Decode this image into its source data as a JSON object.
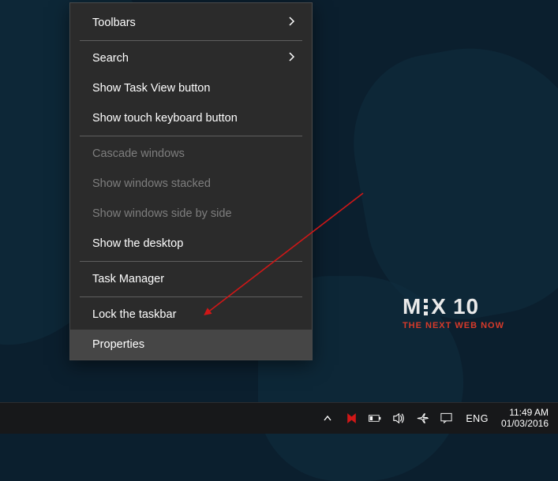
{
  "contextMenu": {
    "items": [
      {
        "label": "Toolbars",
        "enabled": true,
        "submenu": true
      },
      {
        "separator": true
      },
      {
        "label": "Search",
        "enabled": true,
        "submenu": true
      },
      {
        "label": "Show Task View button",
        "enabled": true,
        "submenu": false
      },
      {
        "label": "Show touch keyboard button",
        "enabled": true,
        "submenu": false
      },
      {
        "separator": true
      },
      {
        "label": "Cascade windows",
        "enabled": false,
        "submenu": false
      },
      {
        "label": "Show windows stacked",
        "enabled": false,
        "submenu": false
      },
      {
        "label": "Show windows side by side",
        "enabled": false,
        "submenu": false
      },
      {
        "label": "Show the desktop",
        "enabled": true,
        "submenu": false
      },
      {
        "separator": true
      },
      {
        "label": "Task Manager",
        "enabled": true,
        "submenu": false
      },
      {
        "separator": true
      },
      {
        "label": "Lock the taskbar",
        "enabled": true,
        "submenu": false
      },
      {
        "label": "Properties",
        "enabled": true,
        "submenu": false,
        "hovered": true
      }
    ]
  },
  "brand": {
    "title_a": "M",
    "title_b": "X",
    "title_num": "10",
    "subtitle": "THE NEXT WEB NOW"
  },
  "taskbar": {
    "language": "ENG",
    "time": "11:49 AM",
    "date": "01/03/2016"
  },
  "colors": {
    "arrow": "#d01717",
    "kaspersky": "#d01717"
  }
}
